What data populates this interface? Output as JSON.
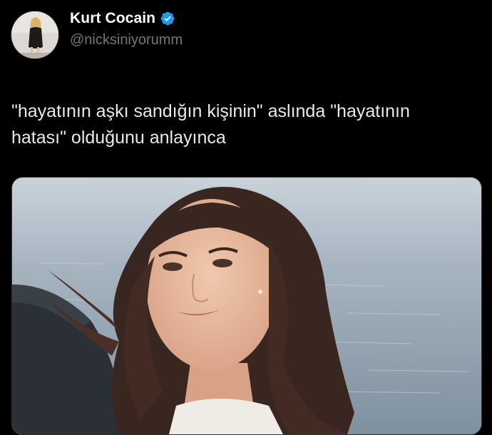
{
  "tweet": {
    "author": {
      "display_name": "Kurt Cocain",
      "handle": "@nicksiniyorumm",
      "verified": true,
      "avatar_icon": "profile-avatar-image",
      "verified_icon": "verified-badge-icon"
    },
    "text_line1": "\"hayatının aşkı sandığın kişinin\" aslında \"hayatının",
    "text_line2": "hatası\" olduğunu anlayınca",
    "media": {
      "kind": "photo",
      "icon": "photo-woman-by-sea"
    }
  },
  "colors": {
    "background": "#000000",
    "name": "#ffffff",
    "handle": "#71767b",
    "text": "#e7e9ea",
    "verified": "#1d9bf0"
  }
}
